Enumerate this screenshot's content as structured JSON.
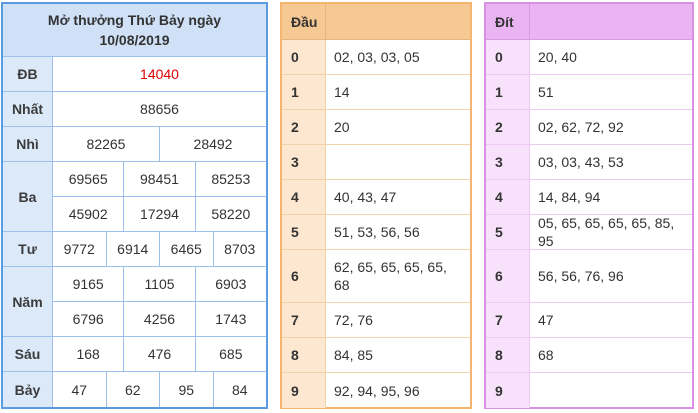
{
  "results": {
    "title_line1": "Mở thưởng Thứ Bảy ngày",
    "title_line2": "10/08/2019",
    "rows": [
      {
        "label": "ĐB",
        "lines": [
          [
            "14040"
          ]
        ]
      },
      {
        "label": "Nhất",
        "lines": [
          [
            "88656"
          ]
        ]
      },
      {
        "label": "Nhì",
        "lines": [
          [
            "82265",
            "28492"
          ]
        ]
      },
      {
        "label": "Ba",
        "lines": [
          [
            "69565",
            "98451",
            "85253"
          ],
          [
            "45902",
            "17294",
            "58220"
          ]
        ]
      },
      {
        "label": "Tư",
        "lines": [
          [
            "9772",
            "6914",
            "6465",
            "8703"
          ]
        ]
      },
      {
        "label": "Năm",
        "lines": [
          [
            "9165",
            "1105",
            "6903"
          ],
          [
            "6796",
            "4256",
            "1743"
          ]
        ]
      },
      {
        "label": "Sáu",
        "lines": [
          [
            "168",
            "476",
            "685"
          ]
        ]
      },
      {
        "label": "Bảy",
        "lines": [
          [
            "47",
            "62",
            "95",
            "84"
          ]
        ]
      }
    ]
  },
  "dau": {
    "header": "Đầu",
    "rows": [
      {
        "key": "0",
        "value": "02, 03, 03, 05"
      },
      {
        "key": "1",
        "value": "14"
      },
      {
        "key": "2",
        "value": "20"
      },
      {
        "key": "3",
        "value": ""
      },
      {
        "key": "4",
        "value": "40, 43, 47"
      },
      {
        "key": "5",
        "value": "51, 53, 56, 56"
      },
      {
        "key": "6",
        "value": "62, 65, 65, 65, 65, 68"
      },
      {
        "key": "7",
        "value": "72, 76"
      },
      {
        "key": "8",
        "value": "84, 85"
      },
      {
        "key": "9",
        "value": "92, 94, 95, 96"
      }
    ]
  },
  "dit": {
    "header": "Đít",
    "rows": [
      {
        "key": "0",
        "value": "20, 40"
      },
      {
        "key": "1",
        "value": "51"
      },
      {
        "key": "2",
        "value": "02, 62, 72, 92"
      },
      {
        "key": "3",
        "value": "03, 03, 43, 53"
      },
      {
        "key": "4",
        "value": "14, 84, 94"
      },
      {
        "key": "5",
        "value": "05, 65, 65, 65, 65, 85, 95"
      },
      {
        "key": "6",
        "value": "56, 56, 76, 96"
      },
      {
        "key": "7",
        "value": "47"
      },
      {
        "key": "8",
        "value": "68"
      },
      {
        "key": "9",
        "value": ""
      }
    ]
  },
  "colors": {
    "special_prize": "#e00000",
    "results_border": "#5b9be0",
    "dau_border": "#f5b56f",
    "dit_border": "#d88fe4"
  }
}
